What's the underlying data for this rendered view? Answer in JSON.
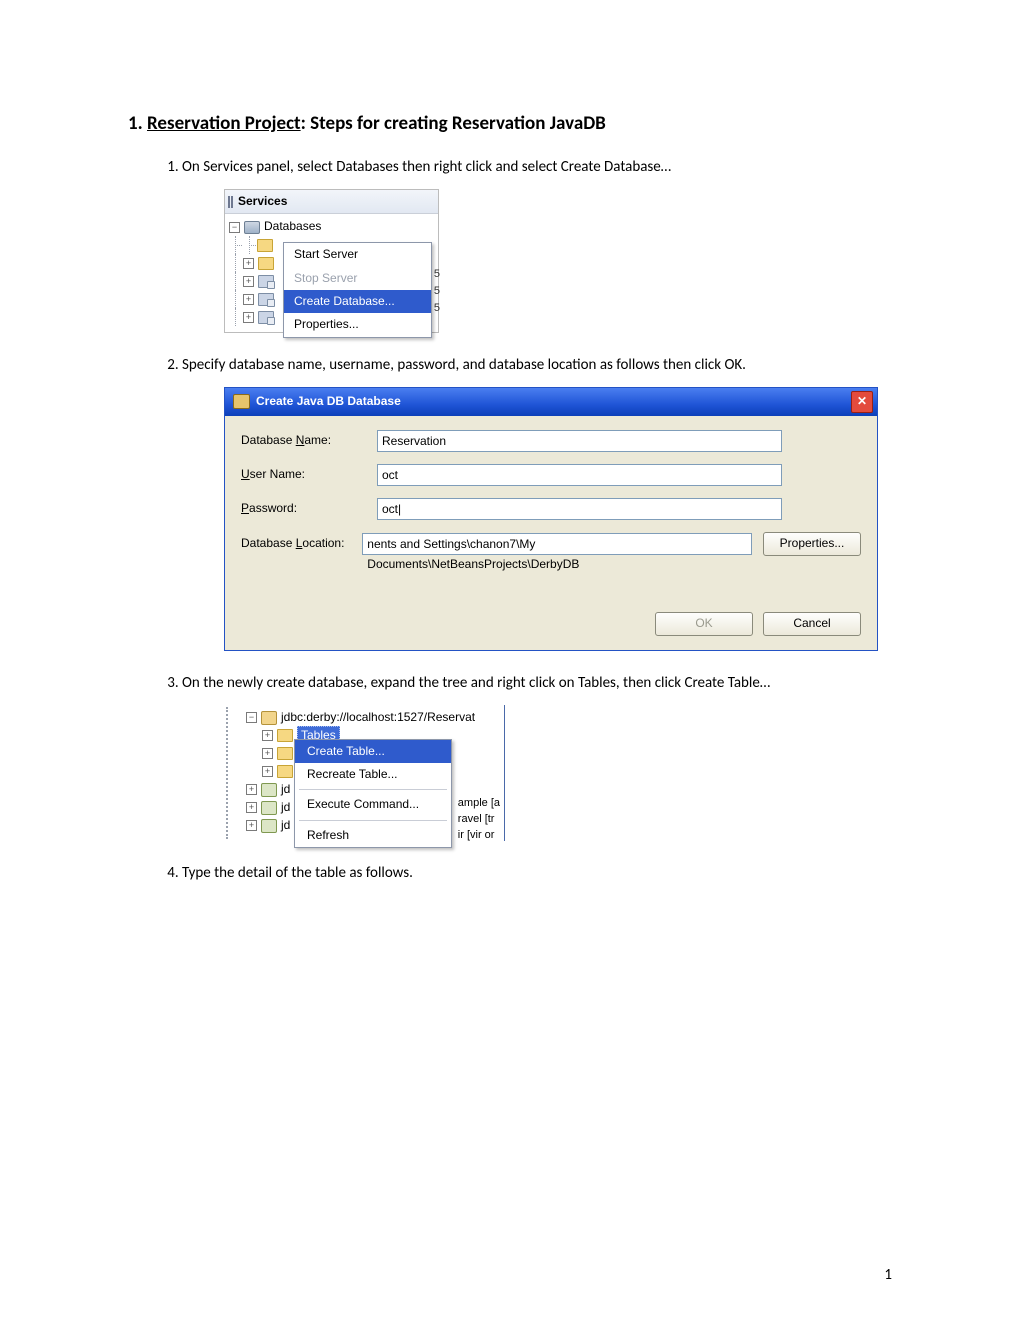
{
  "heading": {
    "number": "1.",
    "title_underlined": "Reservation Project",
    "title_rest": ": Steps for creating Reservation JavaDB"
  },
  "steps": {
    "s1": "On Services panel, select Databases then right click and select Create Database…",
    "s2": "Specify database name, username, password, and database location as follows then click OK.",
    "s3": "On the newly create database, expand the tree and right click on Tables, then click Create Table…",
    "s4": "Type the detail of the table as follows."
  },
  "ss1": {
    "panel_title": "Services",
    "root": "Databases",
    "menu": {
      "start": "Start Server",
      "stop": "Stop Server",
      "create": "Create Database...",
      "props": "Properties..."
    },
    "side_digits": "5"
  },
  "ss2": {
    "title": "Create Java DB Database",
    "labels": {
      "dbname_pre": "Database ",
      "dbname_u": "N",
      "dbname_post": "ame:",
      "user_u": "U",
      "user_post": "ser Name:",
      "pass_u": "P",
      "pass_post": "assword:",
      "loc_pre": "Database ",
      "loc_u": "L",
      "loc_post": "ocation:"
    },
    "values": {
      "dbname": "Reservation",
      "user": "oct",
      "pass": "oct|",
      "location": "nents and Settings\\chanon7\\My Documents\\NetBeansProjects\\DerbyDB"
    },
    "buttons": {
      "props": "Properties...",
      "ok": "OK",
      "cancel": "Cancel"
    }
  },
  "ss3": {
    "conn": "jdbc:derby://localhost:1527/Reservat",
    "tables": "Tables",
    "menu": {
      "create": "Create Table...",
      "recreate": "Recreate Table...",
      "exec": "Execute Command...",
      "refresh": "Refresh"
    },
    "right": {
      "a": "ample [a",
      "b": "ravel [tr",
      "c": "ir [vir or"
    },
    "jd": "jd"
  },
  "page_number": "1"
}
